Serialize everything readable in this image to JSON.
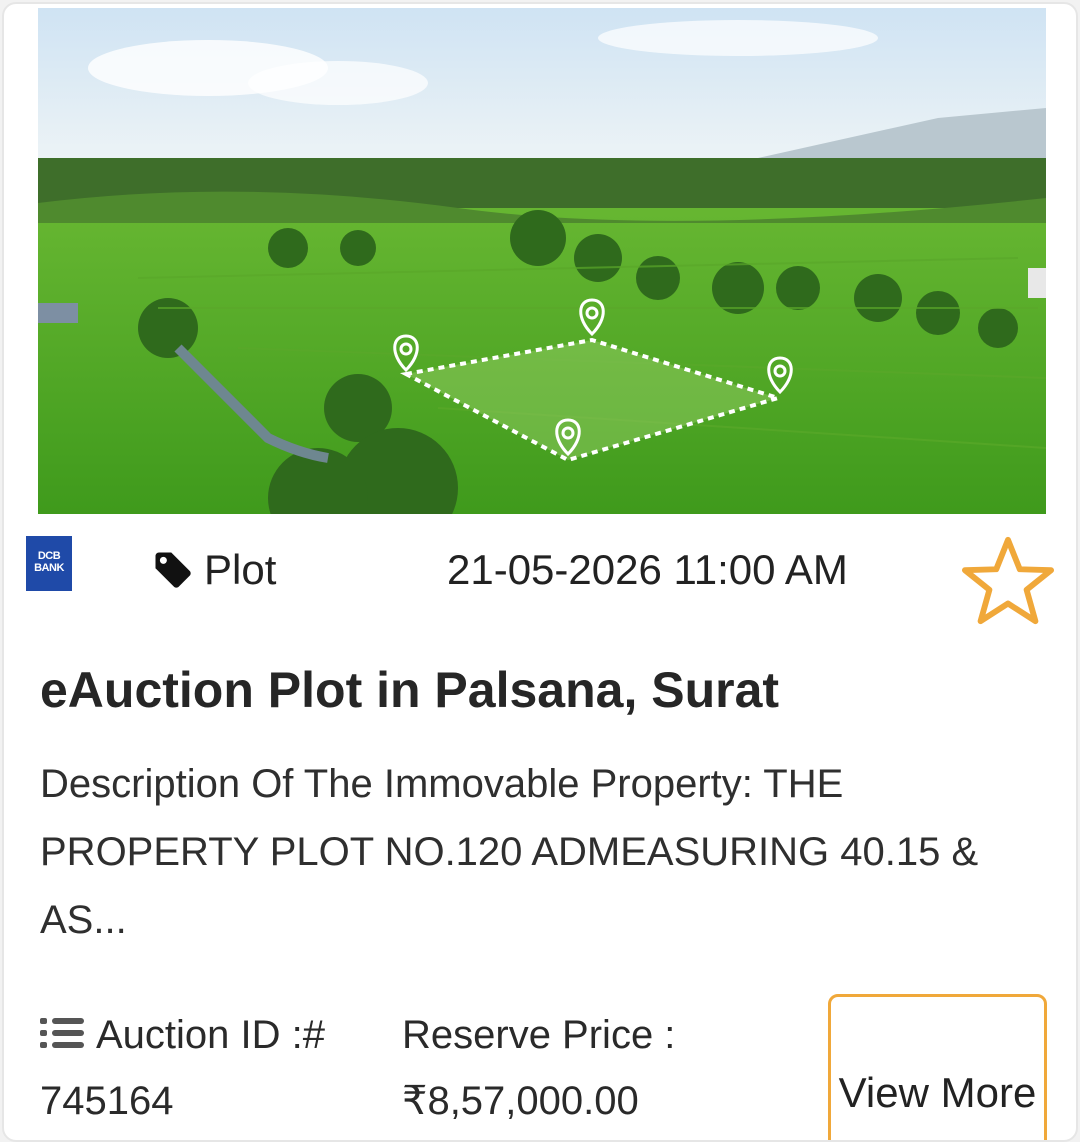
{
  "listing": {
    "image_alt": "Aerial view of green fields with a marked plot boundary",
    "bank_logo": {
      "line1": "DCB",
      "line2": "BANK"
    },
    "category": "Plot",
    "category_icon": "tag-icon",
    "auction_datetime": "21-05-2026 11:00 AM",
    "favorite_icon": "star-outline-icon",
    "title": "eAuction Plot in Palsana, Surat",
    "description": "Description Of The Immovable Property: THE PROPERTY PLOT NO.120 ADMEASURING 40.15 & AS...",
    "auction_id_label": "Auction ID :#",
    "auction_id_value": "745164",
    "reserve_price_label": "Reserve Price :",
    "reserve_price_value": "₹8,57,000.00",
    "view_more_label": "View More"
  },
  "colors": {
    "accent": "#f0a83a",
    "bank_blue": "#1f4aa8",
    "text": "#222222"
  }
}
